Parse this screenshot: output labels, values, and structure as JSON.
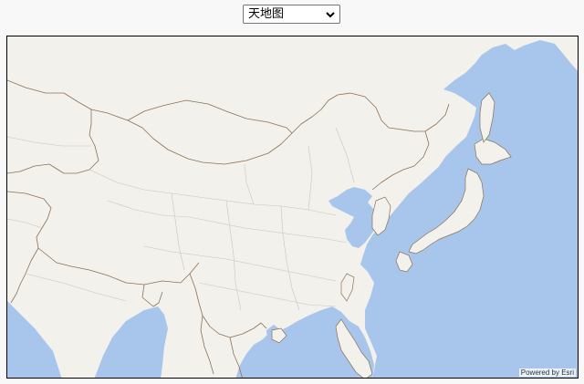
{
  "basemap_select": {
    "selected": "天地图"
  },
  "map": {
    "attribution": "Powered by Esri",
    "colors": {
      "land": "#f2f1ec",
      "water": "#a8c5ec",
      "country_border": "#8c7155",
      "province_border": "#c9c6bf"
    }
  }
}
